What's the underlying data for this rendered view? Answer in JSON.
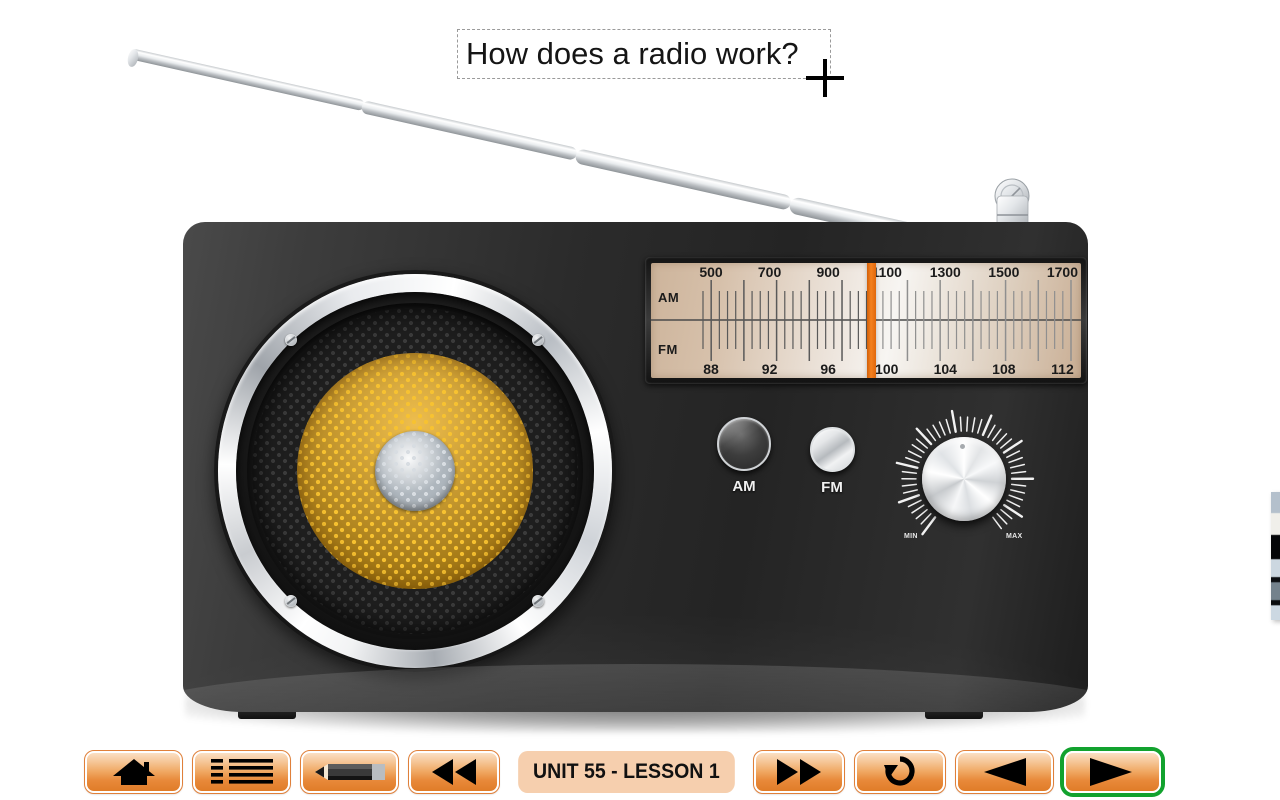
{
  "page": {
    "title": "How does a radio work?",
    "background_color": "#ffffff",
    "cursor": "crosshair-cursor"
  },
  "device": {
    "name": "radio-receiver",
    "body_color": "#2b2b2b",
    "antenna": {
      "name": "telescopic-antenna",
      "segments": 4,
      "color": "#d8dadd"
    },
    "side_knob": {
      "name": "side-tuning-knob"
    },
    "speaker": {
      "name": "loudspeaker",
      "cone_color": "#e8a813",
      "ring_color": "#d7dadd",
      "screws": 4
    },
    "tuner": {
      "name": "tuner-dial",
      "needle_color": "#ef7d1a",
      "needle_position_pct": 50,
      "bands": [
        {
          "label": "AM",
          "ticks": [
            "500",
            "700",
            "900",
            "1100",
            "1300",
            "1500",
            "1700"
          ]
        },
        {
          "label": "FM",
          "ticks": [
            "88",
            "92",
            "96",
            "100",
            "104",
            "108",
            "112"
          ]
        }
      ],
      "faceplate_color": "#e3d4c1"
    },
    "controls": [
      {
        "name": "am-button",
        "label": "AM",
        "state": "pressed"
      },
      {
        "name": "fm-button",
        "label": "FM",
        "state": "released"
      }
    ],
    "volume_knob": {
      "name": "volume-knob",
      "min_label": "MIN",
      "max_label": "MAX"
    }
  },
  "toolbar": {
    "home_label": "home-icon",
    "index_label": "list-icon",
    "pencil_label": "pencil-icon",
    "rewind_label": "rewind-icon",
    "unit_label": "UNIT 55 - LESSON 1",
    "forward_label": "fast-forward-icon",
    "replay_label": "replay-icon",
    "prev_label": "previous-icon",
    "next_label": "next-icon",
    "accent_color": "#e8893a",
    "highlight_color": "#12a22e",
    "label_bg_color": "#f6cfae"
  }
}
